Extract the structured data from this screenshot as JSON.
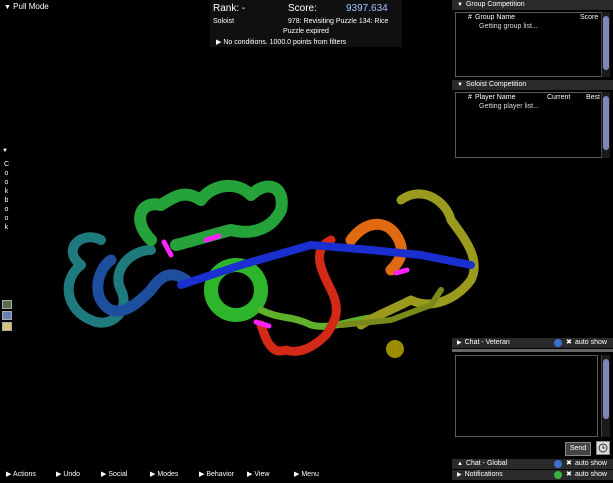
{
  "pull_mode": {
    "label": "Pull Mode"
  },
  "score_panel": {
    "rank_label": "Rank: -",
    "score_label": "Score:",
    "score_value": "9397.634",
    "mode": "Soloist",
    "puzzle_title": "978: Revisiting Puzzle 134: Rice",
    "status": "Puzzle expired",
    "conditions": "No conditions. 1000.0 points from filters"
  },
  "group_competition": {
    "title": "Group Competition",
    "col_num": "#",
    "col_name": "Group Name",
    "col_score": "Score",
    "loading": "Getting group list..."
  },
  "soloist_competition": {
    "title": "Soloist Competition",
    "col_num": "#",
    "col_name": "Player Name",
    "col_current": "Current",
    "col_best": "Best",
    "loading": "Getting player list..."
  },
  "chat_veteran": {
    "title": "Chat - Veteran",
    "auto_show": "auto show"
  },
  "chat_global": {
    "title": "Chat - Global",
    "auto_show": "auto show"
  },
  "notifications": {
    "title": "Notifications",
    "auto_show": "auto show"
  },
  "send_label": "Send",
  "cookbook": {
    "letters": [
      "C",
      "o",
      "o",
      "k",
      "b",
      "o",
      "o",
      "k"
    ]
  },
  "bottom_menu": [
    "Actions",
    "Undo",
    "Social",
    "Modes",
    "Behavior",
    "View",
    "Menu"
  ],
  "colors": {
    "score_value": "#9ec8ff",
    "panel_header": "#2a2a2a",
    "scroll_thumb": "#7d88b8",
    "info_icon": "#3b6fd1",
    "notif_icon": "#37b040"
  },
  "icons": {
    "collapse": "triangle-down",
    "menu_arrow": "triangle-right",
    "info": "info-icon",
    "close": "x-icon",
    "clock": "clock-icon"
  }
}
